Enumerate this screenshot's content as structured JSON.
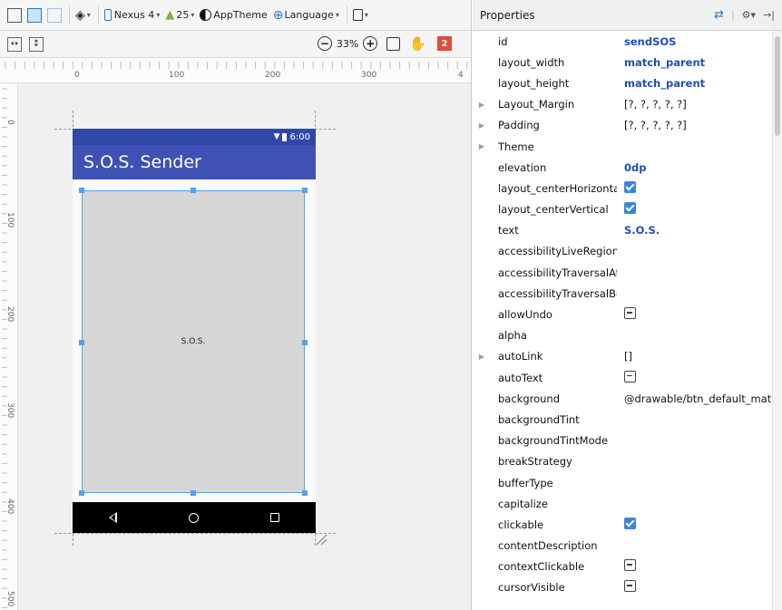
{
  "toolbar": {
    "device_label": "Nexus 4",
    "api_label": "25",
    "theme_label": "AppTheme",
    "language_label": "Language",
    "zoom_label": "33%",
    "warning_count": "2",
    "icons": [
      "design-surface-icon",
      "blueprint-icon",
      "side-by-side-icon",
      "orientation-icon",
      "device-icon",
      "android-icon",
      "theme-icon",
      "globe-icon",
      "layout-variant-icon",
      "expand-horizontal-icon",
      "expand-vertical-icon",
      "zoom-out-icon",
      "zoom-in-icon",
      "zoom-fit-icon",
      "pan-hand-icon"
    ]
  },
  "rulers": {
    "horizontal": [
      "0",
      "100",
      "200",
      "300",
      "4"
    ],
    "vertical": [
      "0",
      "100",
      "200",
      "300",
      "400",
      "500"
    ]
  },
  "phone": {
    "status_time": "6:00",
    "app_title": "S.O.S. Sender",
    "button_text": "S.O.S.",
    "status_color": "#3149a6",
    "appbar_color": "#3f51b5",
    "selection_color": "#56a3e6"
  },
  "properties": {
    "title": "Properties",
    "rows": [
      {
        "name": "id",
        "value": "sendSOS",
        "kind": "blue"
      },
      {
        "name": "layout_width",
        "value": "match_parent",
        "kind": "blue"
      },
      {
        "name": "layout_height",
        "value": "match_parent",
        "kind": "blue"
      },
      {
        "name": "Layout_Margin",
        "value": "[?, ?, ?, ?, ?]",
        "kind": "text",
        "expandable": true
      },
      {
        "name": "Padding",
        "value": "[?, ?, ?, ?, ?]",
        "kind": "text",
        "expandable": true
      },
      {
        "name": "Theme",
        "value": "",
        "kind": "text",
        "expandable": true
      },
      {
        "name": "elevation",
        "value": "0dp",
        "kind": "blue"
      },
      {
        "name": "layout_centerHorizontal",
        "value": "",
        "kind": "check"
      },
      {
        "name": "layout_centerVertical",
        "value": "",
        "kind": "check"
      },
      {
        "name": "text",
        "value": "S.O.S.",
        "kind": "blue"
      },
      {
        "name": "accessibilityLiveRegion",
        "value": "",
        "kind": "text"
      },
      {
        "name": "accessibilityTraversalAfte",
        "value": "",
        "kind": "text"
      },
      {
        "name": "accessibilityTraversalBefc",
        "value": "",
        "kind": "text"
      },
      {
        "name": "allowUndo",
        "value": "",
        "kind": "tri"
      },
      {
        "name": "alpha",
        "value": "",
        "kind": "text"
      },
      {
        "name": "autoLink",
        "value": "[]",
        "kind": "text",
        "expandable": true
      },
      {
        "name": "autoText",
        "value": "",
        "kind": "tri"
      },
      {
        "name": "background",
        "value": "@drawable/btn_default_mat",
        "kind": "text"
      },
      {
        "name": "backgroundTint",
        "value": "",
        "kind": "text"
      },
      {
        "name": "backgroundTintMode",
        "value": "",
        "kind": "text"
      },
      {
        "name": "breakStrategy",
        "value": "",
        "kind": "text"
      },
      {
        "name": "bufferType",
        "value": "",
        "kind": "text"
      },
      {
        "name": "capitalize",
        "value": "",
        "kind": "text"
      },
      {
        "name": "clickable",
        "value": "",
        "kind": "check"
      },
      {
        "name": "contentDescription",
        "value": "",
        "kind": "text"
      },
      {
        "name": "contextClickable",
        "value": "",
        "kind": "tri"
      },
      {
        "name": "cursorVisible",
        "value": "",
        "kind": "tri"
      }
    ]
  }
}
